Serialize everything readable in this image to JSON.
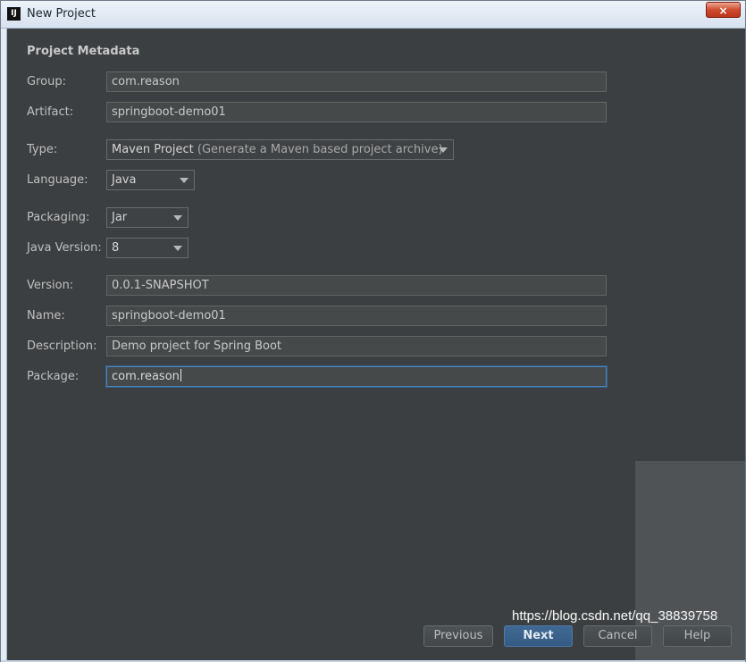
{
  "window": {
    "title": "New Project",
    "app_icon_text": "IJ",
    "close_label": "×"
  },
  "form": {
    "section_title": "Project Metadata",
    "fields": {
      "group": {
        "label": "Group:",
        "value": "com.reason"
      },
      "artifact": {
        "label": "Artifact:",
        "value": "springboot-demo01"
      },
      "type": {
        "label": "Type:",
        "value": "Maven Project",
        "hint": "(Generate a Maven based project archive)"
      },
      "language": {
        "label": "Language:",
        "value": "Java"
      },
      "packaging": {
        "label": "Packaging:",
        "value": "Jar"
      },
      "java_version": {
        "label": "Java Version:",
        "value": "8"
      },
      "version": {
        "label": "Version:",
        "value": "0.0.1-SNAPSHOT"
      },
      "name": {
        "label": "Name:",
        "value": "springboot-demo01"
      },
      "description": {
        "label": "Description:",
        "value": "Demo project for Spring Boot"
      },
      "package": {
        "label": "Package:",
        "value": "com.reason"
      }
    }
  },
  "buttons": {
    "previous": "Previous",
    "next": "Next",
    "cancel": "Cancel",
    "help": "Help"
  },
  "watermark": "https://blog.csdn.net/qq_38839758",
  "colors": {
    "background": "#3c3f41",
    "field": "#45494a",
    "focus": "#4c83bf",
    "primary_button": "#3f6994"
  }
}
